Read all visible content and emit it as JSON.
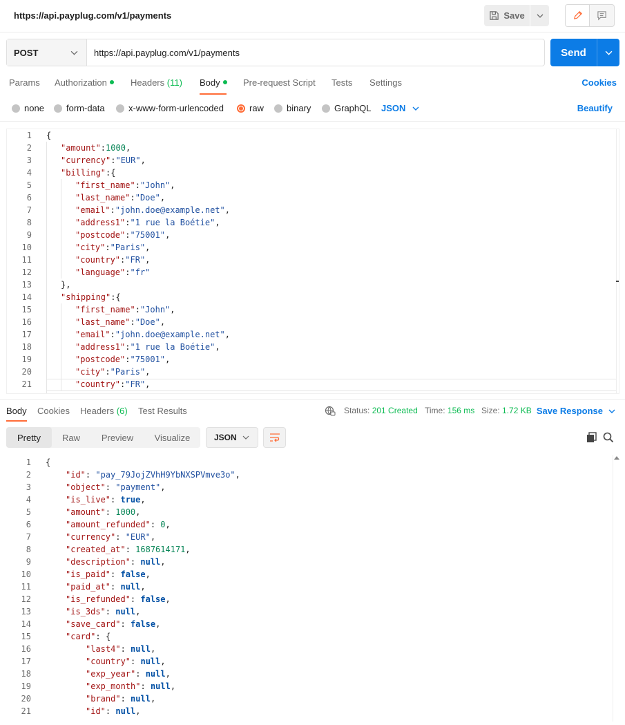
{
  "header": {
    "title": "https://api.payplug.com/v1/payments",
    "save_label": "Save"
  },
  "request": {
    "method": "POST",
    "url": "https://api.payplug.com/v1/payments",
    "send_label": "Send"
  },
  "request_tabs": {
    "params": "Params",
    "authorization": "Authorization",
    "headers": "Headers",
    "headers_count": "(11)",
    "body": "Body",
    "prerequest": "Pre-request Script",
    "tests": "Tests",
    "settings": "Settings",
    "cookies": "Cookies"
  },
  "body_types": {
    "none": "none",
    "form_data": "form-data",
    "urlencoded": "x-www-form-urlencoded",
    "raw": "raw",
    "binary": "binary",
    "graphql": "GraphQL",
    "format": "JSON",
    "beautify": "Beautify"
  },
  "request_body": [
    {
      "n": "1",
      "t": "{",
      "i": 0
    },
    {
      "n": "2",
      "k": "\"amount\"",
      "v": "1000",
      "vt": "n",
      "c": ",",
      "i": 1
    },
    {
      "n": "3",
      "k": "\"currency\"",
      "v": "\"EUR\"",
      "vt": "s",
      "c": ",",
      "i": 1
    },
    {
      "n": "4",
      "k": "\"billing\"",
      "v": "{",
      "vt": "p",
      "c": "",
      "i": 1
    },
    {
      "n": "5",
      "k": "\"first_name\"",
      "v": "\"John\"",
      "vt": "s",
      "c": ",",
      "i": 2
    },
    {
      "n": "6",
      "k": "\"last_name\"",
      "v": "\"Doe\"",
      "vt": "s",
      "c": ",",
      "i": 2
    },
    {
      "n": "7",
      "k": "\"email\"",
      "v": "\"john.doe@example.net\"",
      "vt": "s",
      "c": ",",
      "i": 2
    },
    {
      "n": "8",
      "k": "\"address1\"",
      "v": "\"1 rue la Boétie\"",
      "vt": "s",
      "c": ",",
      "i": 2
    },
    {
      "n": "9",
      "k": "\"postcode\"",
      "v": "\"75001\"",
      "vt": "s",
      "c": ",",
      "i": 2
    },
    {
      "n": "10",
      "k": "\"city\"",
      "v": "\"Paris\"",
      "vt": "s",
      "c": ",",
      "i": 2
    },
    {
      "n": "11",
      "k": "\"country\"",
      "v": "\"FR\"",
      "vt": "s",
      "c": ",",
      "i": 2
    },
    {
      "n": "12",
      "k": "\"language\"",
      "v": "\"fr\"",
      "vt": "s",
      "c": "",
      "i": 2
    },
    {
      "n": "13",
      "t": "},",
      "i": 1
    },
    {
      "n": "14",
      "k": "\"shipping\"",
      "v": "{",
      "vt": "p",
      "c": "",
      "i": 1
    },
    {
      "n": "15",
      "k": "\"first_name\"",
      "v": "\"John\"",
      "vt": "s",
      "c": ",",
      "i": 2
    },
    {
      "n": "16",
      "k": "\"last_name\"",
      "v": "\"Doe\"",
      "vt": "s",
      "c": ",",
      "i": 2
    },
    {
      "n": "17",
      "k": "\"email\"",
      "v": "\"john.doe@example.net\"",
      "vt": "s",
      "c": ",",
      "i": 2
    },
    {
      "n": "18",
      "k": "\"address1\"",
      "v": "\"1 rue la Boétie\"",
      "vt": "s",
      "c": ",",
      "i": 2
    },
    {
      "n": "19",
      "k": "\"postcode\"",
      "v": "\"75001\"",
      "vt": "s",
      "c": ",",
      "i": 2
    },
    {
      "n": "20",
      "k": "\"city\"",
      "v": "\"Paris\"",
      "vt": "s",
      "c": ",",
      "i": 2
    },
    {
      "n": "21",
      "k": "\"country\"",
      "v": "\"FR\"",
      "vt": "s",
      "c": ",",
      "i": 2
    }
  ],
  "response_tabs": {
    "body": "Body",
    "cookies": "Cookies",
    "headers": "Headers",
    "headers_count": "(6)",
    "test_results": "Test Results",
    "status_label": "Status:",
    "status_value": "201 Created",
    "time_label": "Time:",
    "time_value": "156 ms",
    "size_label": "Size:",
    "size_value": "1.72 KB",
    "save_response": "Save Response"
  },
  "response_toolbar": {
    "pretty": "Pretty",
    "raw": "Raw",
    "preview": "Preview",
    "visualize": "Visualize",
    "format": "JSON"
  },
  "response_body": [
    {
      "n": "1",
      "t": "{",
      "i": 0
    },
    {
      "n": "2",
      "k": "\"id\"",
      "v": "\"pay_79JojZVhH9YbNXSPVmve3o\"",
      "vt": "s",
      "c": ",",
      "i": 1
    },
    {
      "n": "3",
      "k": "\"object\"",
      "v": "\"payment\"",
      "vt": "s",
      "c": ",",
      "i": 1
    },
    {
      "n": "4",
      "k": "\"is_live\"",
      "v": "true",
      "vt": "b",
      "c": ",",
      "i": 1
    },
    {
      "n": "5",
      "k": "\"amount\"",
      "v": "1000",
      "vt": "n",
      "c": ",",
      "i": 1
    },
    {
      "n": "6",
      "k": "\"amount_refunded\"",
      "v": "0",
      "vt": "n",
      "c": ",",
      "i": 1
    },
    {
      "n": "7",
      "k": "\"currency\"",
      "v": "\"EUR\"",
      "vt": "s",
      "c": ",",
      "i": 1
    },
    {
      "n": "8",
      "k": "\"created_at\"",
      "v": "1687614171",
      "vt": "n",
      "c": ",",
      "i": 1
    },
    {
      "n": "9",
      "k": "\"description\"",
      "v": "null",
      "vt": "b",
      "c": ",",
      "i": 1
    },
    {
      "n": "10",
      "k": "\"is_paid\"",
      "v": "false",
      "vt": "b",
      "c": ",",
      "i": 1
    },
    {
      "n": "11",
      "k": "\"paid_at\"",
      "v": "null",
      "vt": "b",
      "c": ",",
      "i": 1
    },
    {
      "n": "12",
      "k": "\"is_refunded\"",
      "v": "false",
      "vt": "b",
      "c": ",",
      "i": 1
    },
    {
      "n": "13",
      "k": "\"is_3ds\"",
      "v": "null",
      "vt": "b",
      "c": ",",
      "i": 1
    },
    {
      "n": "14",
      "k": "\"save_card\"",
      "v": "false",
      "vt": "b",
      "c": ",",
      "i": 1
    },
    {
      "n": "15",
      "k": "\"card\"",
      "v": "{",
      "vt": "p",
      "c": "",
      "i": 1
    },
    {
      "n": "16",
      "k": "\"last4\"",
      "v": "null",
      "vt": "b",
      "c": ",",
      "i": 2
    },
    {
      "n": "17",
      "k": "\"country\"",
      "v": "null",
      "vt": "b",
      "c": ",",
      "i": 2
    },
    {
      "n": "18",
      "k": "\"exp_year\"",
      "v": "null",
      "vt": "b",
      "c": ",",
      "i": 2
    },
    {
      "n": "19",
      "k": "\"exp_month\"",
      "v": "null",
      "vt": "b",
      "c": ",",
      "i": 2
    },
    {
      "n": "20",
      "k": "\"brand\"",
      "v": "null",
      "vt": "b",
      "c": ",",
      "i": 2
    },
    {
      "n": "21",
      "k": "\"id\"",
      "v": "null",
      "vt": "b",
      "c": ",",
      "i": 2
    }
  ],
  "colors": {
    "accent": "#ff6c37",
    "primary": "#0c7ce6",
    "success": "#0cbb52"
  },
  "icons": {
    "save": "save-icon",
    "edit": "pencil-icon",
    "comments": "comment-icon",
    "globe": "globe-icon",
    "copy": "copy-icon",
    "search": "search-icon",
    "wrap": "wrap-lines-icon"
  }
}
